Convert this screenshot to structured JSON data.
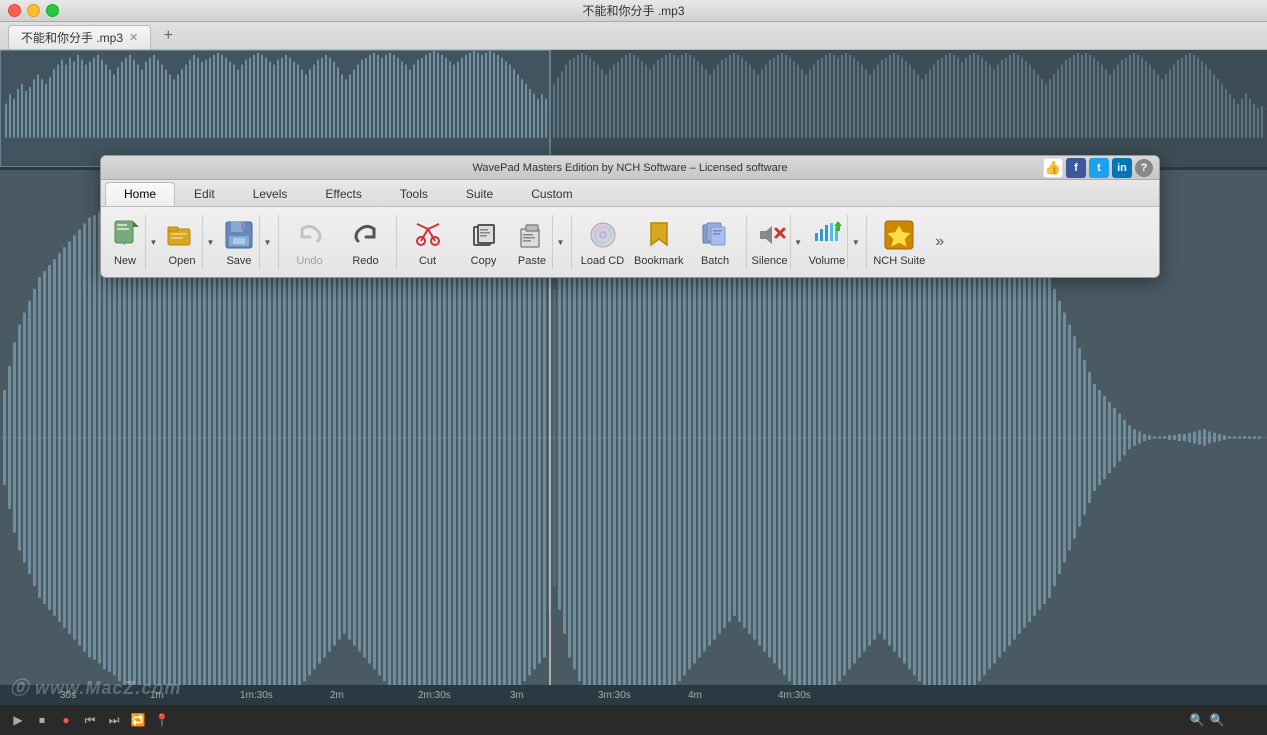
{
  "window": {
    "title": "不能和你分手 .mp3",
    "tab_title": "不能和你分手 .mp3"
  },
  "toolbar": {
    "title": "WavePad Masters Edition by NCH Software – Licensed software",
    "nav_tabs": [
      {
        "id": "home",
        "label": "Home",
        "active": true
      },
      {
        "id": "edit",
        "label": "Edit",
        "active": false
      },
      {
        "id": "levels",
        "label": "Levels",
        "active": false
      },
      {
        "id": "effects",
        "label": "Effects",
        "active": false
      },
      {
        "id": "tools",
        "label": "Tools",
        "active": false
      },
      {
        "id": "suite",
        "label": "Suite",
        "active": false
      },
      {
        "id": "custom",
        "label": "Custom",
        "active": false
      }
    ],
    "buttons": [
      {
        "id": "new",
        "label": "New",
        "icon": "♪",
        "has_dropdown": true
      },
      {
        "id": "open",
        "label": "Open",
        "icon": "📂",
        "has_dropdown": true
      },
      {
        "id": "save",
        "label": "Save",
        "icon": "💾",
        "has_dropdown": true
      },
      {
        "id": "undo",
        "label": "Undo",
        "icon": "↩",
        "disabled": true
      },
      {
        "id": "redo",
        "label": "Redo",
        "icon": "↪",
        "disabled": false
      },
      {
        "id": "cut",
        "label": "Cut",
        "icon": "✂",
        "disabled": false
      },
      {
        "id": "copy",
        "label": "Copy",
        "icon": "⧉",
        "disabled": false
      },
      {
        "id": "paste",
        "label": "Paste",
        "icon": "📋",
        "has_dropdown": true
      },
      {
        "id": "load-cd",
        "label": "Load CD",
        "icon": "💿",
        "disabled": false
      },
      {
        "id": "bookmark",
        "label": "Bookmark",
        "icon": "🔖",
        "disabled": false
      },
      {
        "id": "batch",
        "label": "Batch",
        "icon": "📦",
        "disabled": false
      },
      {
        "id": "silence",
        "label": "Silence",
        "icon": "🔇",
        "has_dropdown": true
      },
      {
        "id": "volume",
        "label": "Volume",
        "icon": "🔊",
        "has_dropdown": true
      },
      {
        "id": "nch-suite",
        "label": "NCH Suite",
        "icon": "🏆",
        "disabled": false
      }
    ],
    "social": [
      {
        "id": "like",
        "label": "👍"
      },
      {
        "id": "facebook",
        "label": "f"
      },
      {
        "id": "twitter",
        "label": "t"
      },
      {
        "id": "linkedin",
        "label": "in"
      },
      {
        "id": "help",
        "label": "?"
      }
    ]
  },
  "timeline": {
    "markers": [
      "30s",
      "1m",
      "1m:30s",
      "2m",
      "2m:30s",
      "3m",
      "3m:30s",
      "4m",
      "4m:30s"
    ]
  },
  "waveform": {
    "color": "#7a9aaa",
    "selection_color": "#5a8a9a",
    "background": "#4a5a62"
  },
  "watermark": "⓪ www.MacZ.com"
}
